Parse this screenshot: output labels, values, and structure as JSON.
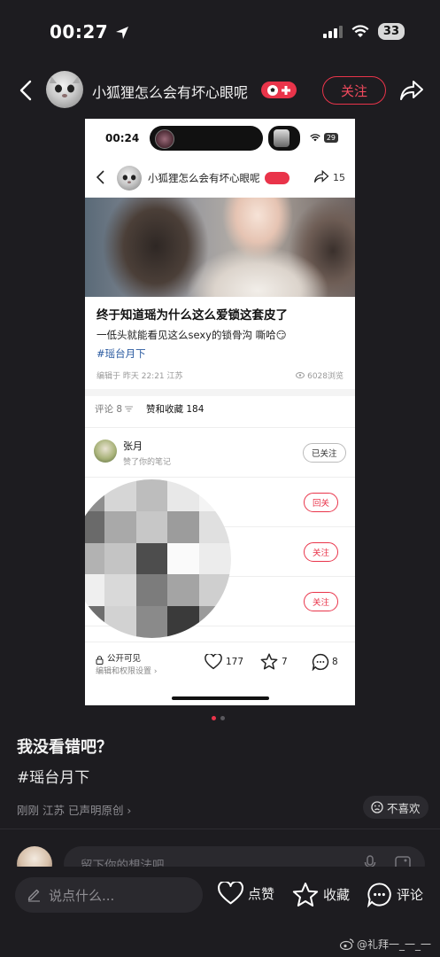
{
  "status_bar": {
    "time": "00:27",
    "battery": "33"
  },
  "header": {
    "author": "小狐狸怎么会有坏心眼呢",
    "follow_label": "关注"
  },
  "inner_screenshot": {
    "time": "00:24",
    "battery": "29",
    "author": "小狐狸怎么会有坏心眼呢",
    "share_count": "15",
    "title": "终于知道瑶为什么这么爱锁这套皮了",
    "desc": "一低头就能看见这么sexy的锁骨沟 嘶哈😏",
    "tag": "#瑶台月下",
    "meta": "编辑于 昨天 22:21 江苏",
    "views": "6028浏览",
    "tab_comments": "评论 8",
    "tab_likes": "赞和收藏 184",
    "notification": {
      "name": "张月",
      "sub": "赞了你的笔记",
      "button": "已关注"
    },
    "row_buttons": [
      "回关",
      "关注",
      "关注"
    ],
    "public_label": "公开可见",
    "public_sub": "编辑和权限设置 ›",
    "like_count": "177",
    "fav_count": "7",
    "comment_count": "8"
  },
  "post": {
    "title": "我没看错吧？",
    "tag": "#瑶台月下",
    "meta": "刚刚 江苏 已声明原创 ›",
    "dislike_label": "不喜欢"
  },
  "comment_box": {
    "placeholder": "留下你的想法吧"
  },
  "bottom_bar": {
    "say_placeholder": "说点什么...",
    "like_label": "点赞",
    "fav_label": "收藏",
    "comment_label": "评论"
  },
  "watermark": "@礼拜一_一_一",
  "colors": {
    "accent": "#e9344a",
    "background": "#1d1c20",
    "tag_blue": "#2a5aa0"
  },
  "icons": [
    "back-icon",
    "share-icon",
    "heart-icon",
    "star-icon",
    "comment-icon",
    "lock-icon",
    "pen-icon",
    "mic-icon",
    "image-icon",
    "dislike-icon",
    "location-arrow-icon",
    "signal-icon",
    "wifi-icon",
    "weibo-icon"
  ]
}
